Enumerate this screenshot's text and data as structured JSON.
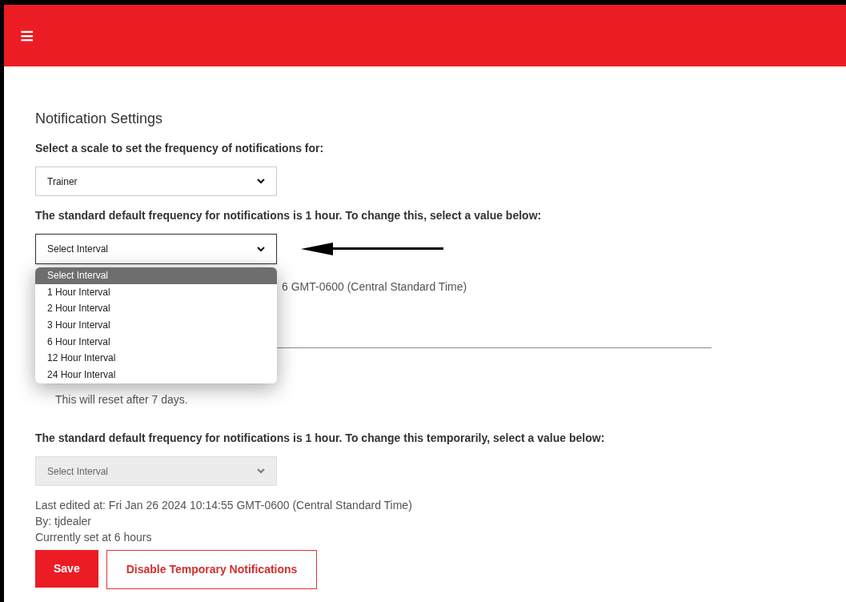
{
  "header": {
    "menu_icon": "≡"
  },
  "title": "Notification Settings",
  "scale_label": "Select a scale to set the frequency of notifications for:",
  "scale_select": {
    "value": "Trainer"
  },
  "default_label": "The standard default frequency for notifications is 1 hour. To change this, select a value below:",
  "interval_select": {
    "value": "Select Interval",
    "expanded": true,
    "options": [
      {
        "label": "Select Interval",
        "selected": true
      },
      {
        "label": "1 Hour Interval",
        "selected": false
      },
      {
        "label": "2 Hour Interval",
        "selected": false
      },
      {
        "label": "3 Hour Interval",
        "selected": false
      },
      {
        "label": "6 Hour Interval",
        "selected": false
      },
      {
        "label": "12 Hour Interval",
        "selected": false
      },
      {
        "label": "24 Hour Interval",
        "selected": false
      }
    ]
  },
  "partial_edited_text": "6 GMT-0600 (Central Standard Time)",
  "reset_note": "This will reset after 7 days.",
  "temporary_label": "The standard default frequency for notifications is 1 hour. To change this temporarily, select a value below:",
  "temporary_select": {
    "value": "Select Interval",
    "disabled": true
  },
  "info_lines": [
    "Last edited at: Fri Jan 26 2024 10:14:55 GMT-0600 (Central Standard Time)",
    "By: tjdealer",
    "Currently set at 6 hours"
  ],
  "buttons": [
    {
      "label": "Save",
      "kind": "primary"
    },
    {
      "label": "Disable Temporary Notifications",
      "kind": "outline"
    }
  ]
}
